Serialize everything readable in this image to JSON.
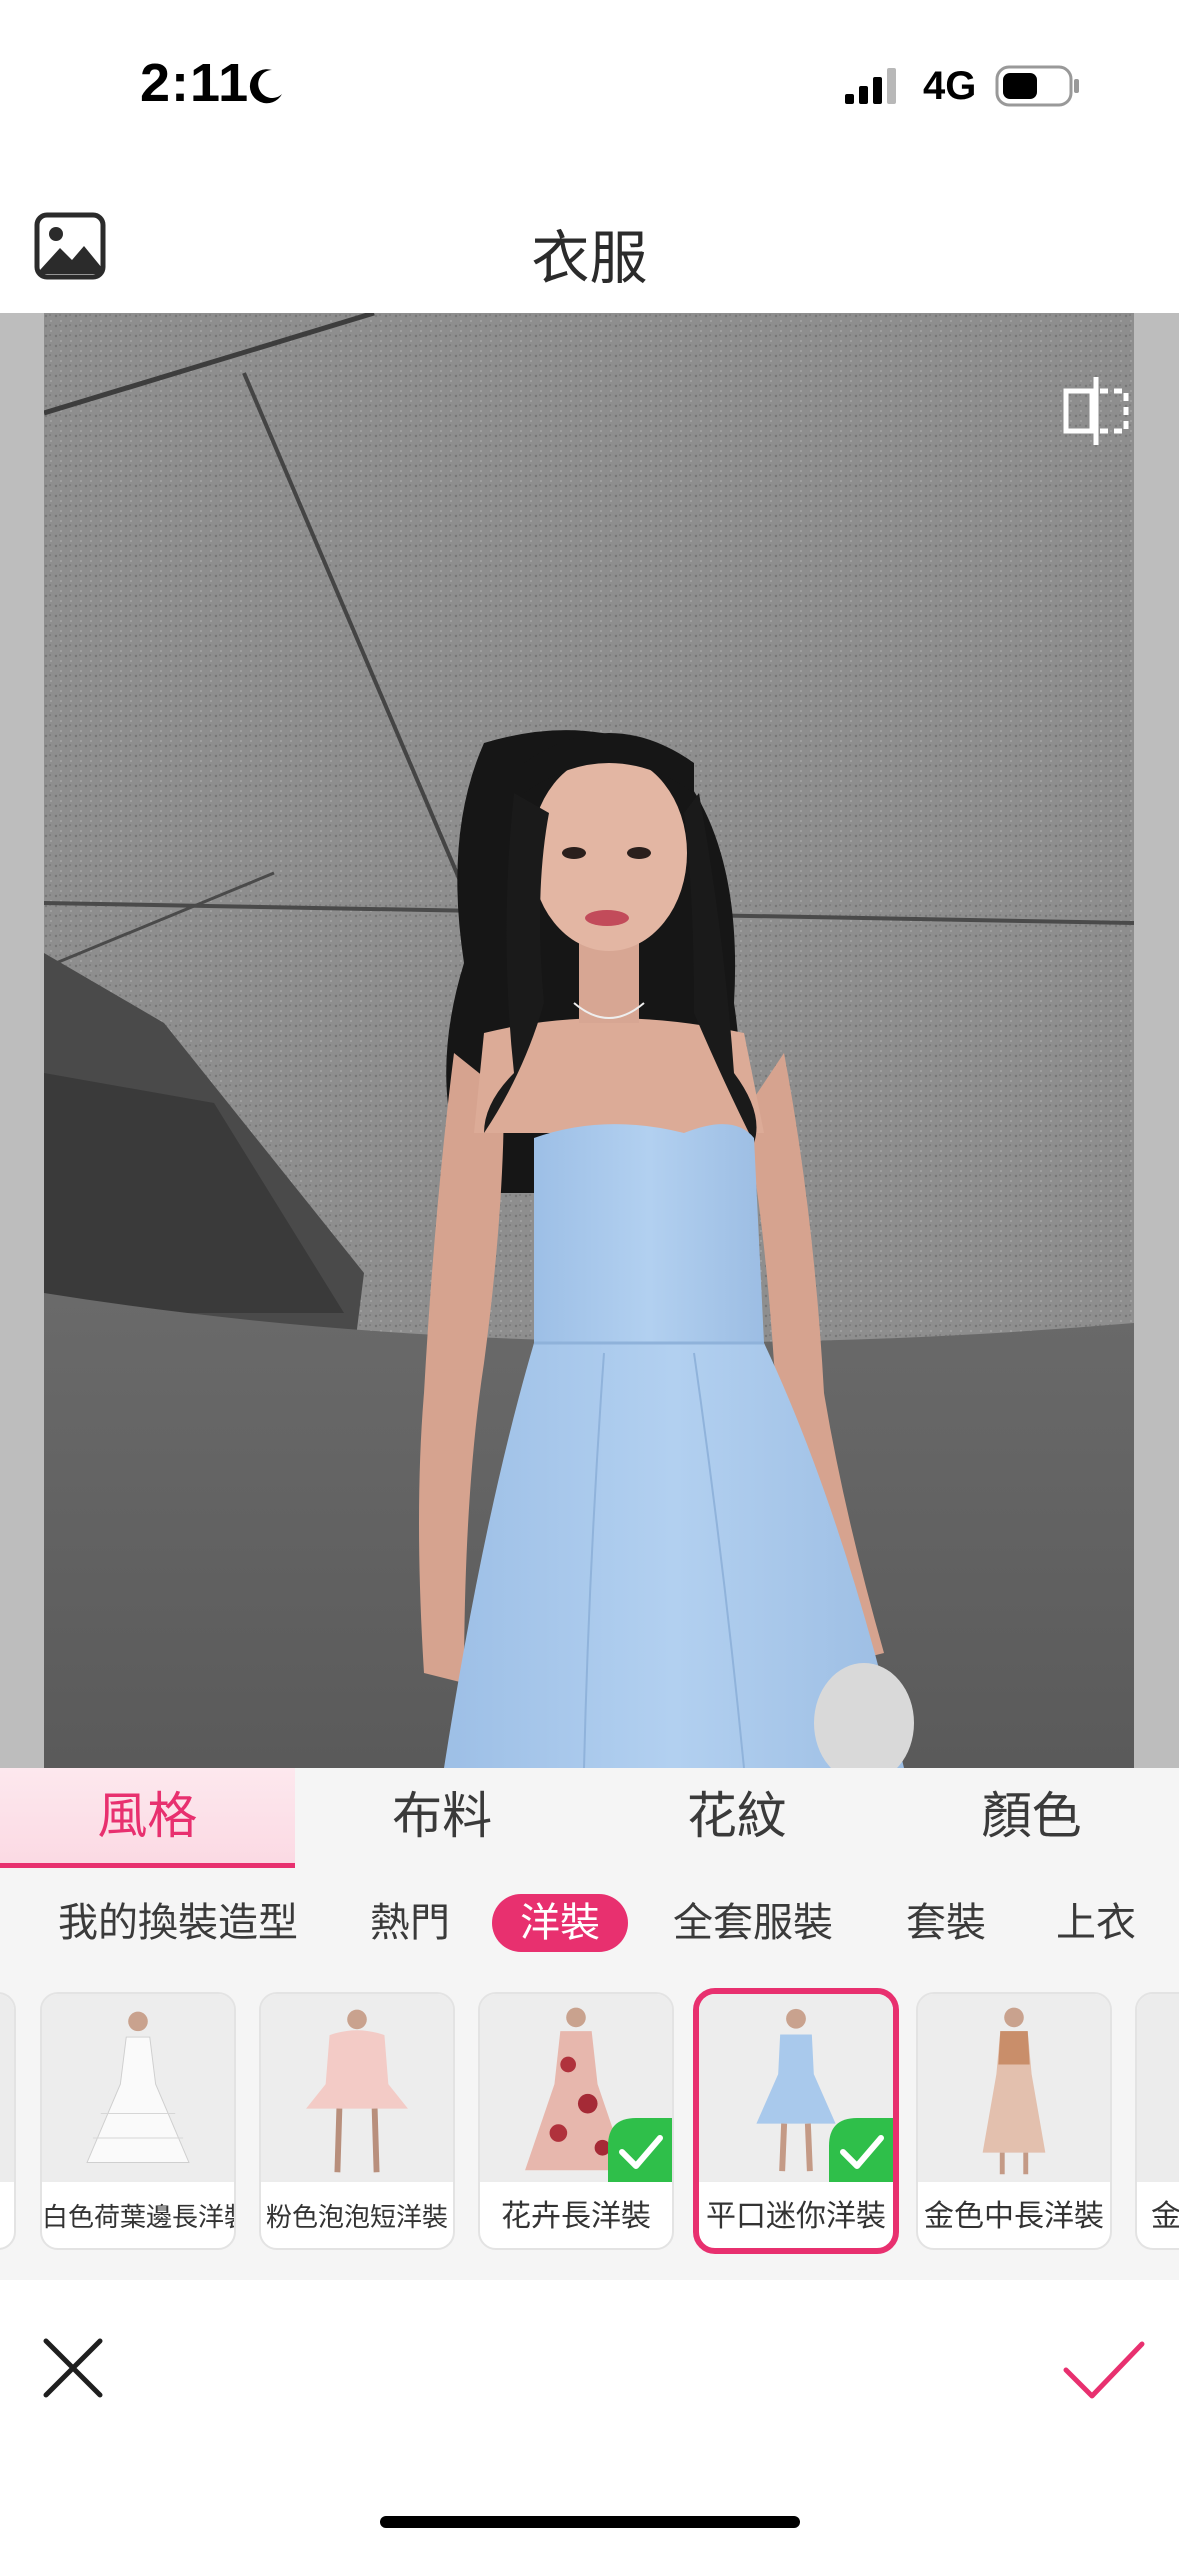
{
  "status": {
    "time": "2:11",
    "network": "4G"
  },
  "header": {
    "title": "衣服"
  },
  "tabs": [
    {
      "label": "風格",
      "active": true
    },
    {
      "label": "布料",
      "active": false
    },
    {
      "label": "花紋",
      "active": false
    },
    {
      "label": "顏色",
      "active": false
    }
  ],
  "subcategories": [
    {
      "label": "我的換裝造型",
      "active": false
    },
    {
      "label": "熱門",
      "active": false
    },
    {
      "label": "洋裝",
      "active": true
    },
    {
      "label": "全套服裝",
      "active": false
    },
    {
      "label": "套裝",
      "active": false
    },
    {
      "label": "上衣",
      "active": false
    }
  ],
  "items": [
    {
      "label": "白色荷葉邊長洋裝",
      "checked": false,
      "selected": false
    },
    {
      "label": "粉色泡泡短洋裝",
      "checked": false,
      "selected": false
    },
    {
      "label": "花卉長洋裝",
      "checked": true,
      "selected": false
    },
    {
      "label": "平口迷你洋裝",
      "checked": true,
      "selected": true
    },
    {
      "label": "金色中長洋裝",
      "checked": false,
      "selected": false
    },
    {
      "label": "金",
      "checked": false,
      "selected": false
    }
  ],
  "colors": {
    "accent": "#e8306f",
    "dress": "#a9c9ec",
    "wall": "#8d8d8d"
  }
}
